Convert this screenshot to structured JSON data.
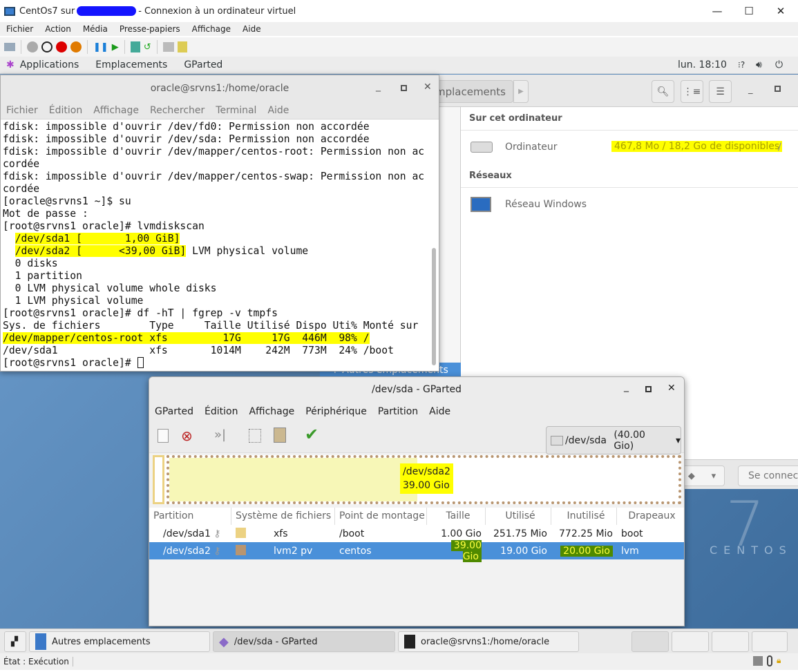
{
  "window": {
    "title_prefix": "CentOs7 sur",
    "title_suffix": "- Connexion à un ordinateur virtuel",
    "controls": [
      "—",
      "☐",
      "✕"
    ]
  },
  "menu": [
    "Fichier",
    "Action",
    "Média",
    "Presse-papiers",
    "Affichage",
    "Aide"
  ],
  "topbar": {
    "applications": "Applications",
    "places": "Emplacements",
    "app": "GParted",
    "clock": "lun. 18:10"
  },
  "nautilus": {
    "path": "Autres emplacements",
    "section1": "Sur cet ordinateur",
    "computer": "Ordinateur",
    "computer_space": "467,8 Mo / 18,2 Go de disponibles",
    "computer_mount": "/",
    "section2": "Réseaux",
    "network": "Réseau Windows",
    "sidebar_other": "Autres emplacements",
    "connect_placeholder": "Se connecter au serveur"
  },
  "terminal": {
    "title": "oracle@srvns1:/home/oracle",
    "menu": [
      "Fichier",
      "Édition",
      "Affichage",
      "Rechercher",
      "Terminal",
      "Aide"
    ],
    "lines": [
      [
        {
          "t": "fdisk: impossible d'ouvrir /dev/fd0: Permission non accordée"
        }
      ],
      [
        {
          "t": "fdisk: impossible d'ouvrir /dev/sda: Permission non accordée"
        }
      ],
      [
        {
          "t": "fdisk: impossible d'ouvrir /dev/mapper/centos-root: Permission non ac"
        }
      ],
      [
        {
          "t": "cordée"
        }
      ],
      [
        {
          "t": "fdisk: impossible d'ouvrir /dev/mapper/centos-swap: Permission non ac"
        }
      ],
      [
        {
          "t": "cordée"
        }
      ],
      [
        {
          "t": "[oracle@srvns1 ~]$ su"
        }
      ],
      [
        {
          "t": "Mot de passe :"
        }
      ],
      [
        {
          "t": "[root@srvns1 oracle]# lvmdiskscan"
        }
      ],
      [
        {
          "t": "  "
        },
        {
          "t": "/dev/sda1 [       1,00 GiB]",
          "hl": true
        }
      ],
      [
        {
          "t": "  "
        },
        {
          "t": "/dev/sda2 [      <39,00 GiB]",
          "hl": true
        },
        {
          "t": " LVM physical volume"
        }
      ],
      [
        {
          "t": "  0 disks"
        }
      ],
      [
        {
          "t": "  1 partition"
        }
      ],
      [
        {
          "t": "  0 LVM physical volume whole disks"
        }
      ],
      [
        {
          "t": "  1 LVM physical volume"
        }
      ],
      [
        {
          "t": "[root@srvns1 oracle]# df -hT | fgrep -v tmpfs"
        }
      ],
      [
        {
          "t": "Sys. de fichiers        Type     Taille Utilisé Dispo Uti% Monté sur"
        }
      ],
      [
        {
          "t": "/dev/mapper/centos-root xfs         17G     17G  446M  98% /",
          "hl": true
        }
      ],
      [
        {
          "t": "/dev/sda1               xfs       1014M    242M  773M  24% /boot"
        }
      ],
      [
        {
          "t": "[root@srvns1 oracle]# "
        }
      ]
    ]
  },
  "gparted": {
    "title": "/dev/sda - GParted",
    "menu": [
      "GParted",
      "Édition",
      "Affichage",
      "Périphérique",
      "Partition",
      "Aide"
    ],
    "device": "/dev/sda",
    "device_size": "(40.00 Gio)",
    "map_label": "/dev/sda2",
    "map_size": "39.00 Gio",
    "map_used_fraction": 0.487,
    "columns": [
      "Partition",
      "Système de fichiers",
      "Point de montage",
      "Taille",
      "Utilisé",
      "Inutilisé",
      "Drapeaux"
    ],
    "rows": [
      {
        "partition": "/dev/sda1",
        "fs": "xfs",
        "fs_color": "#ecd283",
        "mount": "/boot",
        "size": "1.00 Gio",
        "used": "251.75 Mio",
        "unused": "772.25 Mio",
        "flags": "boot"
      },
      {
        "partition": "/dev/sda2",
        "fs": "lvm2 pv",
        "fs_color": "#b89570",
        "mount": "centos",
        "size": "39.00 Gio",
        "used": "19.00 Gio",
        "unused": "20.00 Gio",
        "flags": "lvm",
        "selected": true
      }
    ]
  },
  "desktop": {
    "logo_text": "CENTOS",
    "logo_number": "7"
  },
  "taskbar": [
    "Autres emplacements",
    "/dev/sda - GParted",
    "oracle@srvns1:/home/oracle"
  ],
  "status": {
    "state": "État : Exécution"
  }
}
